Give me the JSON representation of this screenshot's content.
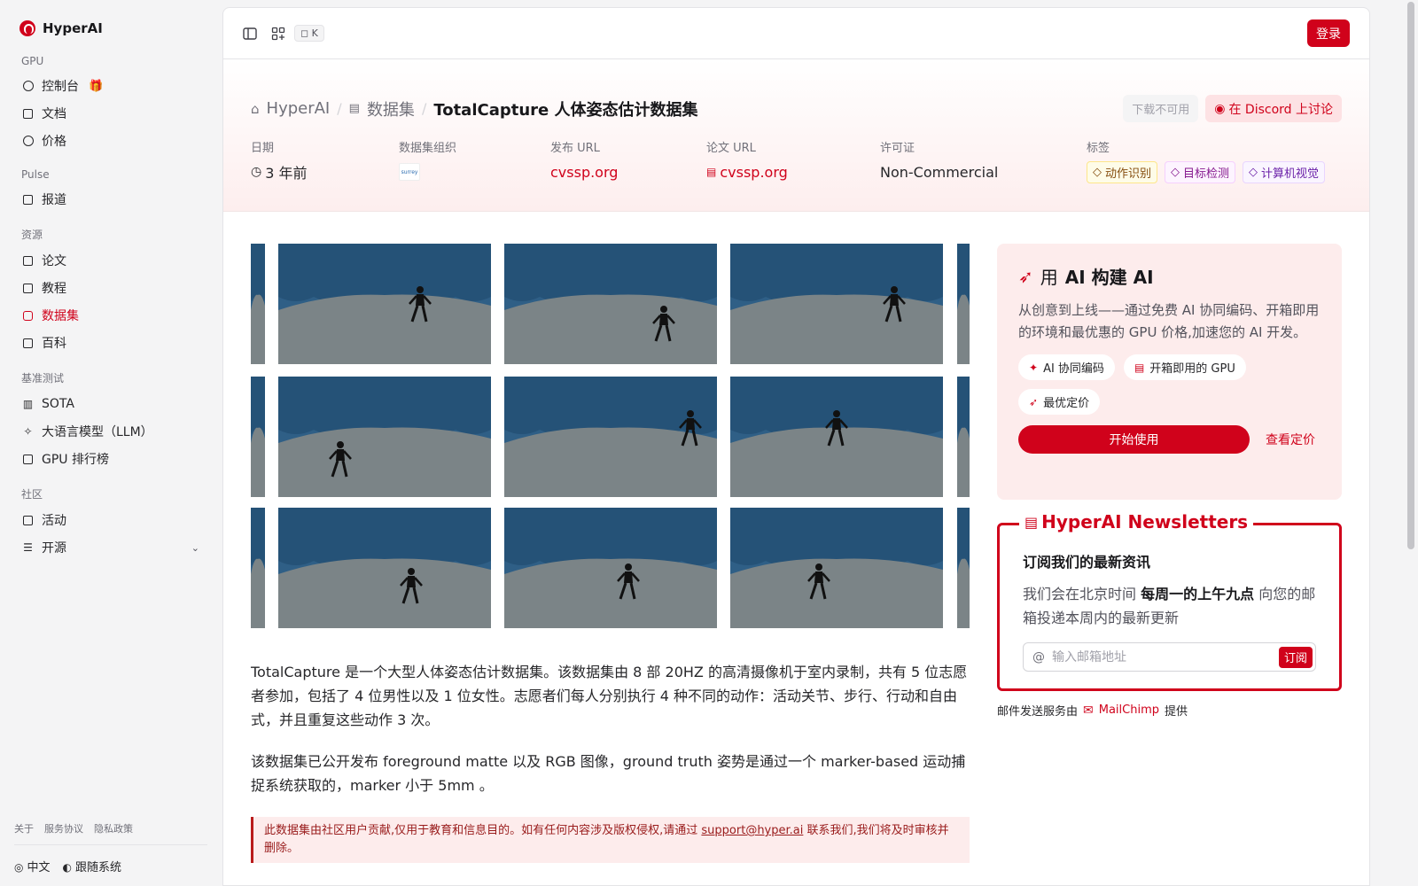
{
  "brand": {
    "name": "HyperAI"
  },
  "sidebar": {
    "sections": [
      {
        "label": "GPU",
        "items": [
          {
            "label": "控制台",
            "icon": "dashboard-icon",
            "badge": "gift-icon"
          },
          {
            "label": "文档",
            "icon": "document-icon"
          },
          {
            "label": "价格",
            "icon": "dollar-icon"
          }
        ]
      },
      {
        "label": "Pulse",
        "items": [
          {
            "label": "报道",
            "icon": "news-icon"
          }
        ]
      },
      {
        "label": "资源",
        "items": [
          {
            "label": "论文",
            "icon": "paper-icon"
          },
          {
            "label": "教程",
            "icon": "book-icon"
          },
          {
            "label": "数据集",
            "icon": "database-icon",
            "active": true
          },
          {
            "label": "百科",
            "icon": "wiki-icon"
          }
        ]
      },
      {
        "label": "基准测试",
        "items": [
          {
            "label": "SOTA",
            "icon": "chart-icon"
          },
          {
            "label": "大语言模型（LLM）",
            "icon": "sparkle-icon"
          },
          {
            "label": "GPU 排行榜",
            "icon": "cpu-icon"
          }
        ]
      },
      {
        "label": "社区",
        "items": [
          {
            "label": "活动",
            "icon": "calendar-icon"
          },
          {
            "label": "开源",
            "icon": "list-icon",
            "expandable": true
          }
        ]
      }
    ],
    "footer_links": [
      "关于",
      "服务协议",
      "隐私政策"
    ],
    "language": "中文",
    "theme": "跟随系统"
  },
  "topbar": {
    "shortcut": "K",
    "login": "登录"
  },
  "breadcrumb": {
    "home": "HyperAI",
    "section": "数据集",
    "current": "TotalCapture 人体姿态估计数据集"
  },
  "actions": {
    "download": "下载不可用",
    "discord": "在 Discord 上讨论"
  },
  "meta": {
    "date_label": "日期",
    "date_value": "3 年前",
    "org_label": "数据集组织",
    "org_logo_text": "surrey",
    "release_label": "发布 URL",
    "release_value": "cvssp.org",
    "paper_label": "论文 URL",
    "paper_value": "cvssp.org",
    "license_label": "许可证",
    "license_value": "Non-Commercial",
    "tags_label": "标签",
    "tags": [
      "动作识别",
      "目标检测",
      "计算机视觉"
    ]
  },
  "description": {
    "p1": "TotalCapture 是一个大型人体姿态估计数据集。该数据集由 8 部 20HZ 的高清摄像机于室内录制，共有 5 位志愿者参加，包括了 4 位男性以及 1 位女性。志愿者们每人分别执行 4 种不同的动作：活动关节、步行、行动和自由式，并且重复这些动作 3 次。",
    "p2": "该数据集已公开发布 foreground matte 以及 RGB 图像，ground truth 姿势是通过一个 marker-based 运动捕捉系统获取的，marker 小于 5mm 。",
    "notice_pre": "此数据集由社区用户贡献,仅用于教育和信息目的。如有任何内容涉及版权侵权,请通过 ",
    "notice_email": "support@hyper.ai",
    "notice_post": " 联系我们,我们将及时审核并删除。"
  },
  "promo": {
    "title_pre": "用 ",
    "title_bold": "AI 构建 AI",
    "desc": "从创意到上线——通过免费 AI 协同编码、开箱即用的环境和最优惠的 GPU 价格,加速您的 AI 开发。",
    "chips": [
      "AI 协同编码",
      "开箱即用的 GPU",
      "最优定价"
    ],
    "start": "开始使用",
    "pricing": "查看定价"
  },
  "newsletter": {
    "legend": "HyperAI Newsletters",
    "heading": "订阅我们的最新资讯",
    "text_pre": "我们会在北京时间 ",
    "text_bold": "每周一的上午九点",
    "text_post": " 向您的邮箱投递本周内的最新更新",
    "placeholder": "输入邮箱地址",
    "subscribe": "订阅",
    "provider_pre": "邮件发送服务由",
    "provider_name": "MailChimp",
    "provider_post": "提供"
  },
  "colors": {
    "accent": "#d0021b",
    "studio_wall": "#2f5f86",
    "studio_floor": "#7b8487"
  }
}
